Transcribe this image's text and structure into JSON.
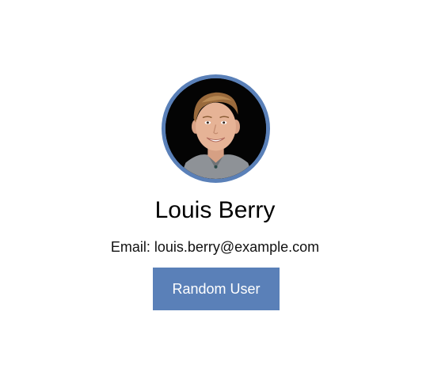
{
  "profile": {
    "name": "Louis Berry",
    "email_label": "Email:",
    "email": "louis.berry@example.com",
    "email_line": "Email: louis.berry@example.com",
    "avatar_icon": "user-portrait-photo"
  },
  "actions": {
    "random_user_label": "Random User"
  },
  "colors": {
    "accent": "#5a80b8",
    "text": "#000000",
    "background": "#ffffff"
  }
}
